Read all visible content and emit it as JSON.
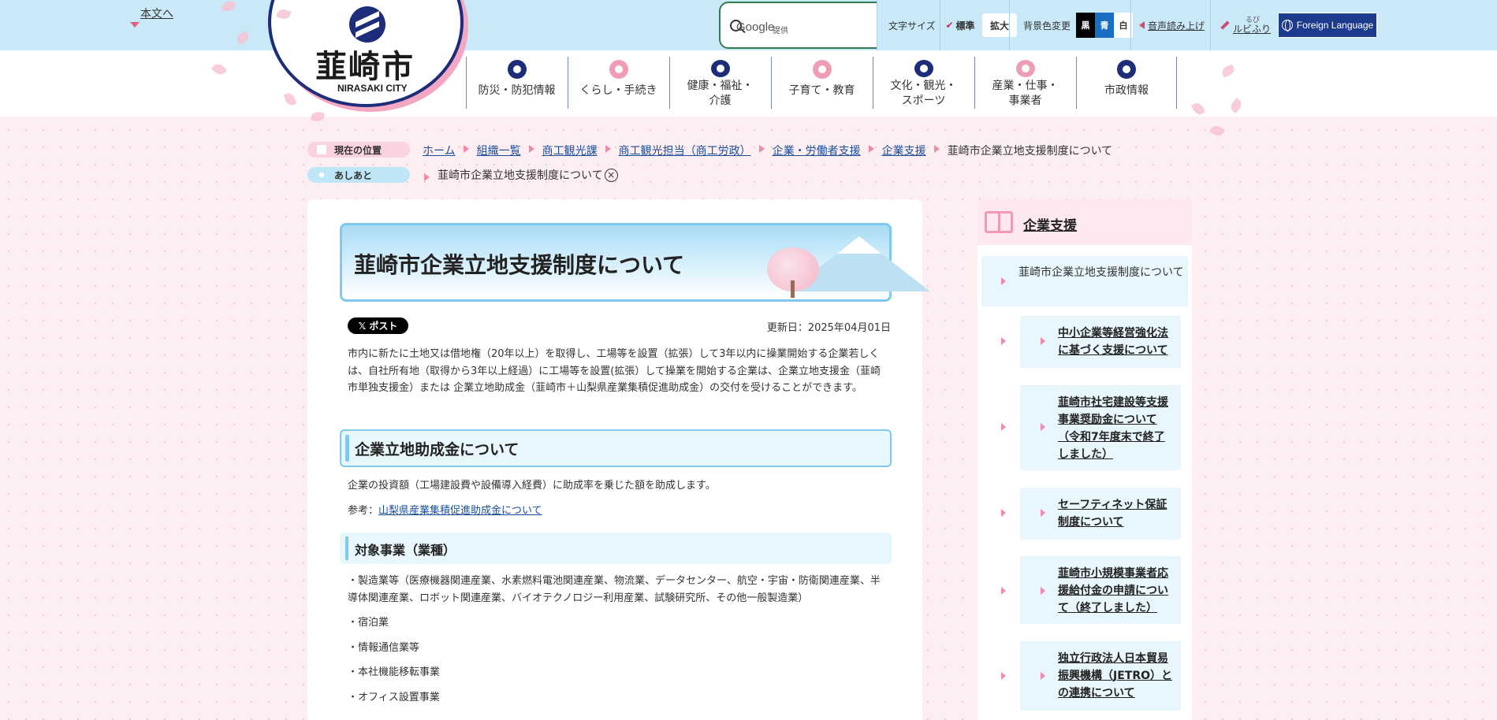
{
  "header": {
    "skip_link": "本文へ",
    "search": {
      "brand": "Google",
      "provided": "提供"
    },
    "font_size": {
      "label": "文字サイズ",
      "standard": "標準",
      "large": "拡大"
    },
    "bg_color": {
      "label": "背景色変更",
      "black": "黒",
      "blue": "青",
      "white": "白"
    },
    "read_aloud": "音声読み上げ",
    "furigana": {
      "ruby": "るび",
      "label": "ルビふり"
    },
    "foreign_language": "Foreign Language"
  },
  "logo": {
    "name_ja": "韮崎市",
    "name_en": "NIRASAKI CITY"
  },
  "nav": [
    {
      "label": "防災・防犯情報",
      "icon": "shield-icon",
      "color": "#1d2d7a"
    },
    {
      "label": "くらし・手続き",
      "icon": "document-icon",
      "color": "#ef9cb5"
    },
    {
      "label": "健康・福祉・\n介護",
      "icon": "heart-hands-icon",
      "color": "#1d2d7a"
    },
    {
      "label": "子育て・教育",
      "icon": "child-icon",
      "color": "#ef9cb5"
    },
    {
      "label": "文化・観光・\nスポーツ",
      "icon": "culture-icon",
      "color": "#1d2d7a"
    },
    {
      "label": "産業・仕事・\n事業者",
      "icon": "worker-icon",
      "color": "#ef9cb5"
    },
    {
      "label": "市政情報",
      "icon": "city-emblem-icon",
      "color": "#1d2d7a"
    }
  ],
  "breadcrumb": {
    "current_label": "現在の位置",
    "items": [
      "ホーム",
      "組織一覧",
      "商工観光課",
      "商工観光担当（商工労政）",
      "企業・労働者支援",
      "企業支援"
    ],
    "current": "韮崎市企業立地支援制度について"
  },
  "history": {
    "label": "あしあと",
    "item": "韮崎市企業立地支援制度について",
    "close": "×"
  },
  "main": {
    "title": "韮崎市企業立地支援制度について",
    "post_button": "𝕏 ポスト",
    "updated": "更新日：2025年04月01日",
    "intro": "市内に新たに土地又は借地権（20年以上）を取得し、工場等を設置（拡張）して3年以内に操業開始する企業若しくは、自社所有地（取得から3年以上経過）に工場等を設置(拡張）して操業を開始する企業は、企業立地支援金（韮崎市単独支援金）または 企業立地助成金（韮崎市＋山梨県産業集積促進助成金）の交付を受けることができます。",
    "section1": {
      "heading": "企業立地助成金について",
      "text": "企業の投資額（工場建設費や設備導入経費）に助成率を乗じた額を助成します。",
      "ref_prefix": "参考：",
      "ref_link": "山梨県産業集積促進助成金について"
    },
    "section2": {
      "heading": "対象事業（業種）",
      "items": [
        "・製造業等（医療機器関連産業、水素燃料電池関連産業、物流業、データセンター、航空・宇宙・防衛関連産業、半導体関連産業、ロボット関連産業、バイオテクノロジー利用産業、試験研究所、その他一般製造業）",
        "・宿泊業",
        "・情報通信業等",
        "・本社機能移転事業",
        "・オフィス設置事業"
      ]
    }
  },
  "sidebar": {
    "title": "企業支援",
    "current": "韮崎市企業立地支援制度について",
    "items": [
      "中小企業等経営強化法に基づく支援について",
      "韮崎市社宅建設等支援事業奨励金について（令和7年度末で終了しました）",
      "セーフティネット保証制度について",
      "韮崎市小規模事業者応援給付金の申請について（終了しました）",
      "独立行政法人日本貿易振興機構（JETRO）との連携について"
    ]
  },
  "colors": {
    "topbar": "#c9e9f8",
    "navy": "#1d2d7a",
    "accent_pink": "#f08aa8",
    "title_border": "#7fc9ef"
  }
}
